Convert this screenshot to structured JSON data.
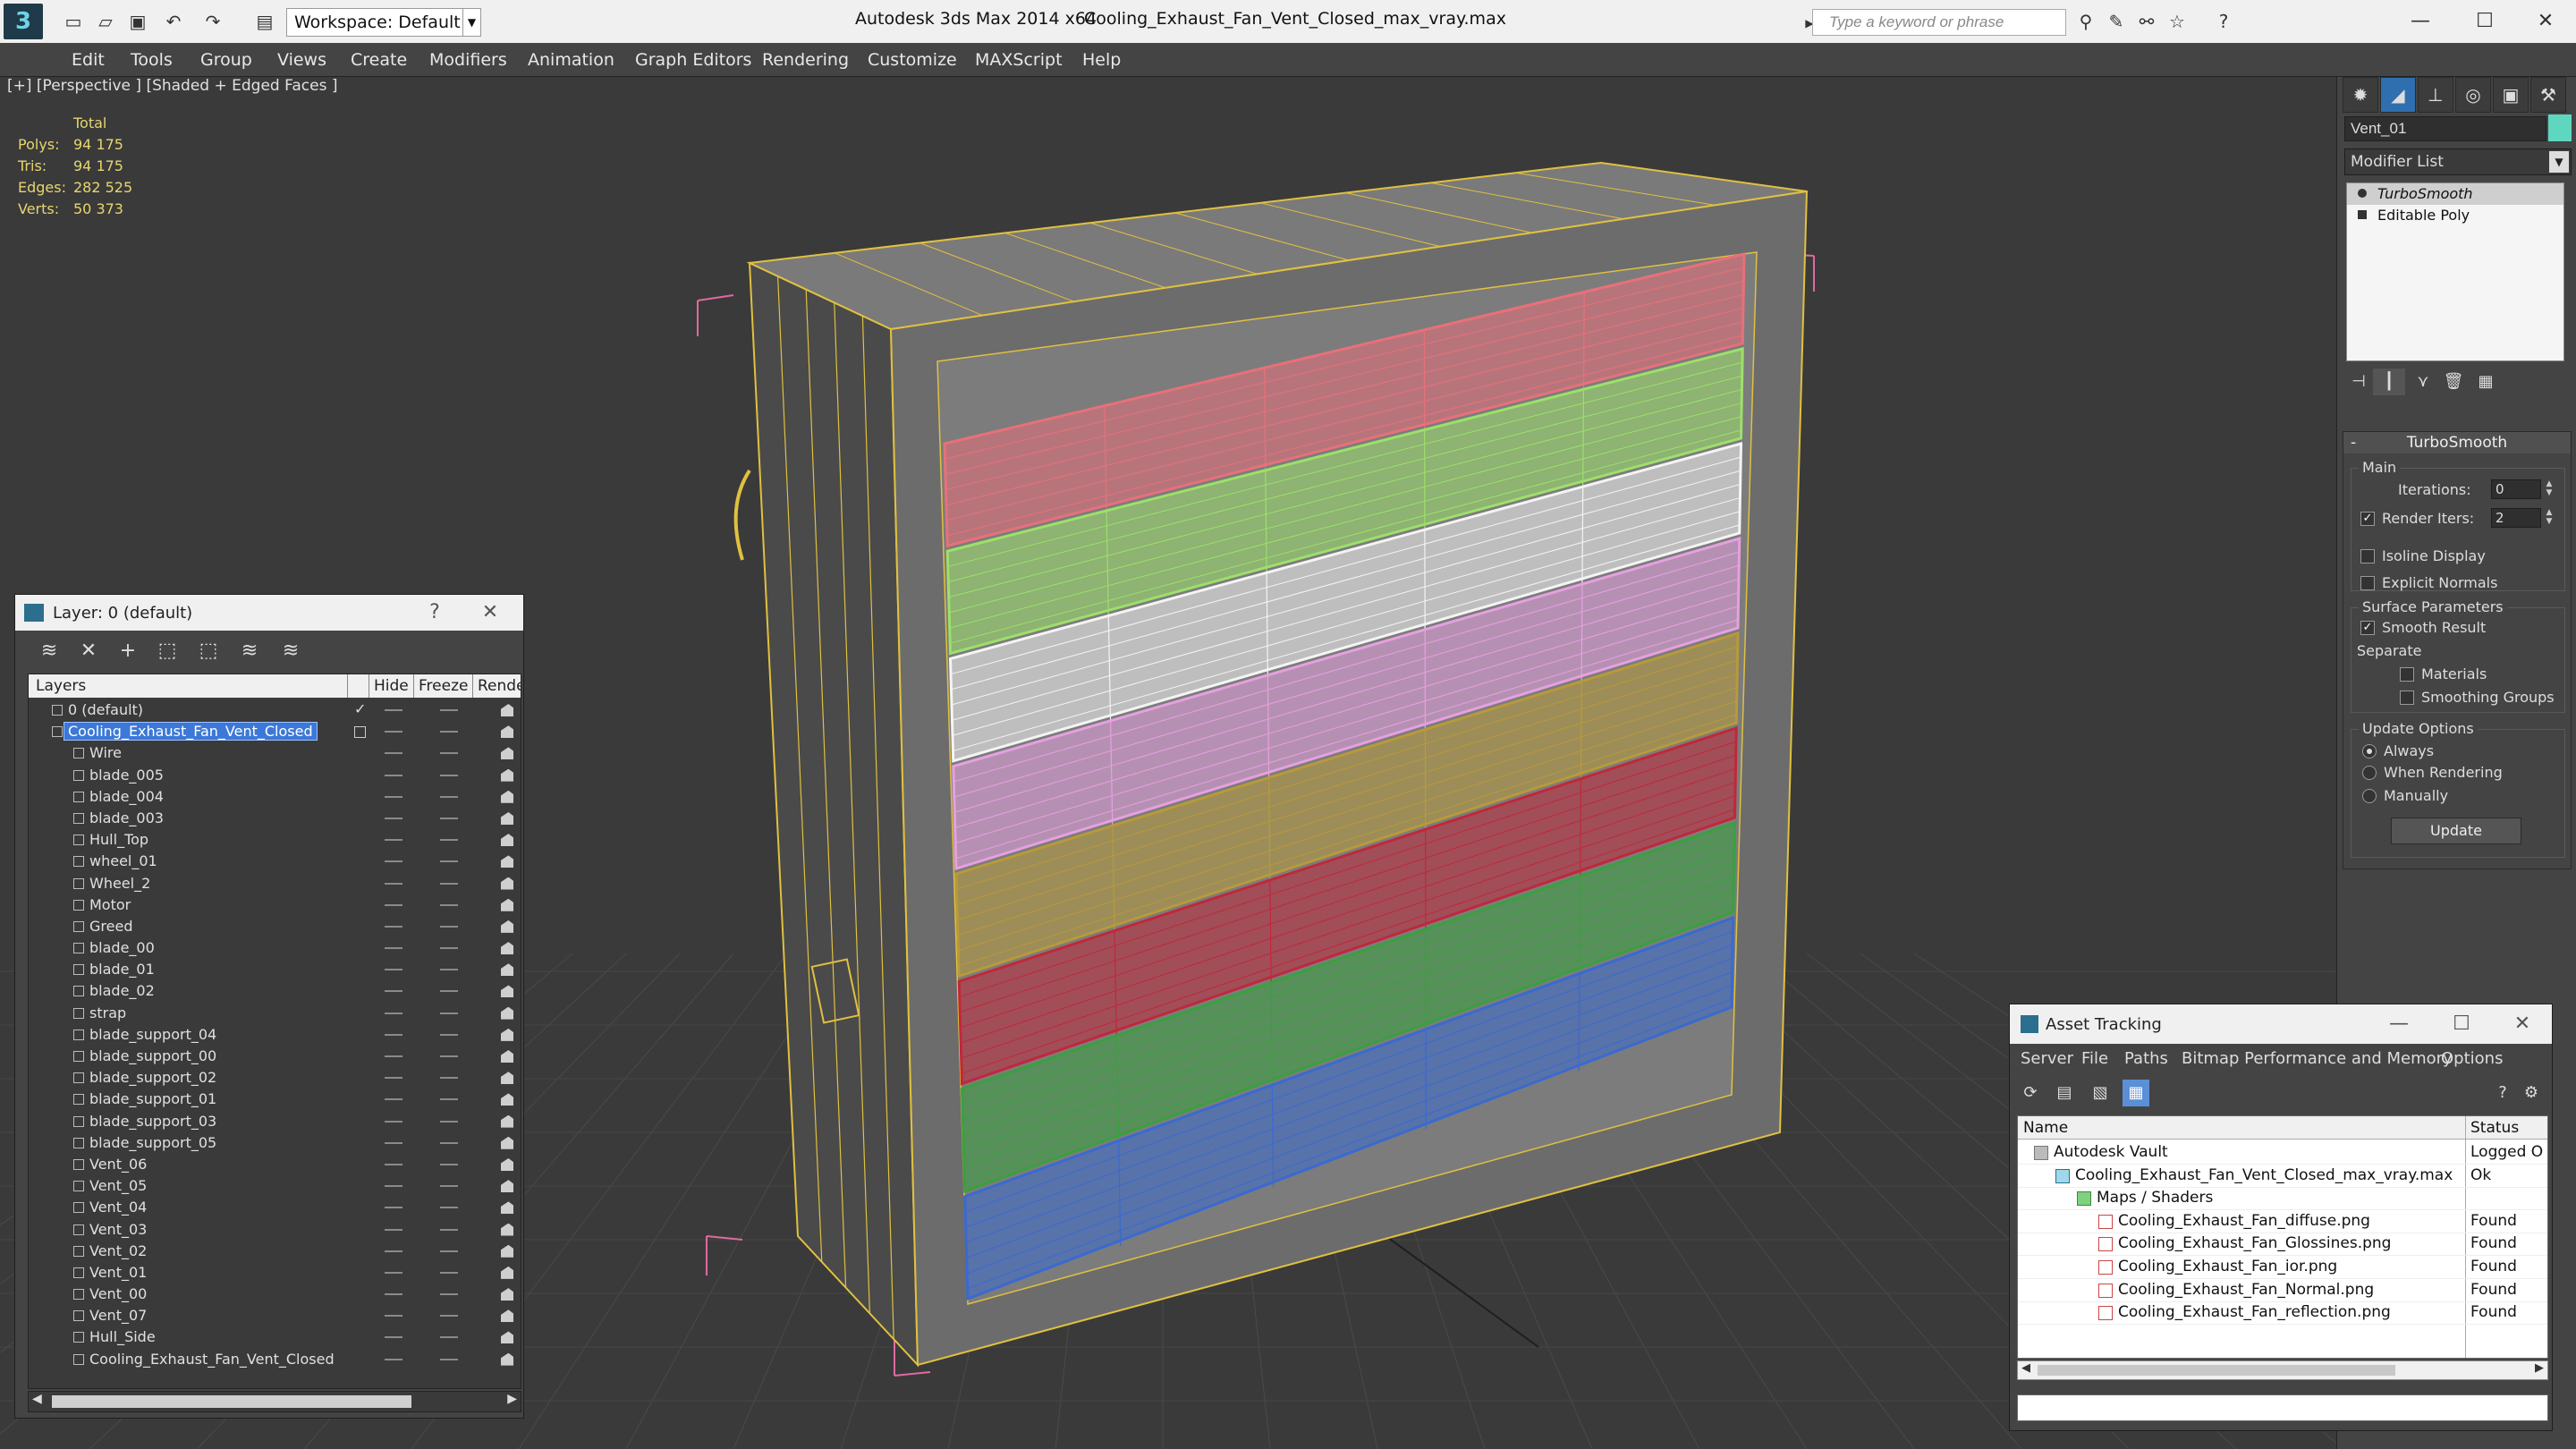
{
  "titlebar": {
    "logo": "3",
    "workspace": "Workspace: Default",
    "app_title": "Autodesk 3ds Max  2014 x64",
    "file_name": "Cooling_Exhaust_Fan_Vent_Closed_max_vray.max",
    "search_placeholder": "Type a keyword or phrase",
    "minimize": "—",
    "maximize": "☐",
    "close": "✕"
  },
  "menubar": [
    "Edit",
    "Tools",
    "Group",
    "Views",
    "Create",
    "Modifiers",
    "Animation",
    "Graph Editors",
    "Rendering",
    "Customize",
    "MAXScript",
    "Help"
  ],
  "viewport": {
    "label": "[+] [Perspective ] [Shaded + Edged Faces ]",
    "stats_header": "Total",
    "stats": [
      {
        "k": "Polys:",
        "v": "94 175"
      },
      {
        "k": "Tris:",
        "v": "94 175"
      },
      {
        "k": "Edges:",
        "v": "282 525"
      },
      {
        "k": "Verts:",
        "v": "50 373"
      }
    ],
    "vent_colors": [
      "#e8707a",
      "#9ce06a",
      "#f4f4f4",
      "#e6a0e0",
      "#b89a3a",
      "#c0283a",
      "#3aa040",
      "#3a6ad0"
    ],
    "frame_color": "#e0c040",
    "bbox_color": "#e06aa0"
  },
  "cmdpanel": {
    "tab_icons": [
      "sun-icon",
      "curve-icon",
      "hierarchy-icon",
      "motion-icon",
      "display-icon",
      "utilities-icon"
    ],
    "object_name": "Vent_01",
    "object_color": "#5fd6c0",
    "modifier_list": "Modifier List",
    "stack": [
      "TurboSmooth",
      "Editable Poly"
    ],
    "rollout_title": "TurboSmooth",
    "main_group": "Main",
    "iterations_label": "Iterations:",
    "iterations_value": "0",
    "render_iters_label": "Render Iters:",
    "render_iters_value": "2",
    "isoline_label": "Isoline Display",
    "explicit_normals_label": "Explicit Normals",
    "surface_group": "Surface Parameters",
    "smooth_result_label": "Smooth Result",
    "separate_label": "Separate",
    "materials_label": "Materials",
    "smoothing_groups_label": "Smoothing Groups",
    "update_group": "Update Options",
    "always_label": "Always",
    "when_rendering_label": "When Rendering",
    "manually_label": "Manually",
    "update_button": "Update"
  },
  "layerdlg": {
    "title": "Layer: 0 (default)",
    "help": "?",
    "close": "✕",
    "columns": {
      "layers": "Layers",
      "hide": "Hide",
      "freeze": "Freeze",
      "render": "Rende"
    },
    "rows": [
      {
        "name": "0 (default)",
        "level": 1,
        "check": true
      },
      {
        "name": "Cooling_Exhaust_Fan_Vent_Closed",
        "level": 1,
        "selected": true
      },
      {
        "name": "Wire",
        "level": 2
      },
      {
        "name": "blade_005",
        "level": 2
      },
      {
        "name": "blade_004",
        "level": 2
      },
      {
        "name": "blade_003",
        "level": 2
      },
      {
        "name": "Hull_Top",
        "level": 2
      },
      {
        "name": "wheel_01",
        "level": 2
      },
      {
        "name": "Wheel_2",
        "level": 2
      },
      {
        "name": "Motor",
        "level": 2
      },
      {
        "name": "Greed",
        "level": 2
      },
      {
        "name": "blade_00",
        "level": 2
      },
      {
        "name": "blade_01",
        "level": 2
      },
      {
        "name": "blade_02",
        "level": 2
      },
      {
        "name": "strap",
        "level": 2
      },
      {
        "name": "blade_support_04",
        "level": 2
      },
      {
        "name": "blade_support_00",
        "level": 2
      },
      {
        "name": "blade_support_02",
        "level": 2
      },
      {
        "name": "blade_support_01",
        "level": 2
      },
      {
        "name": "blade_support_03",
        "level": 2
      },
      {
        "name": "blade_support_05",
        "level": 2
      },
      {
        "name": "Vent_06",
        "level": 2
      },
      {
        "name": "Vent_05",
        "level": 2
      },
      {
        "name": "Vent_04",
        "level": 2
      },
      {
        "name": "Vent_03",
        "level": 2
      },
      {
        "name": "Vent_02",
        "level": 2
      },
      {
        "name": "Vent_01",
        "level": 2
      },
      {
        "name": "Vent_00",
        "level": 2
      },
      {
        "name": "Vent_07",
        "level": 2
      },
      {
        "name": "Hull_Side",
        "level": 2
      },
      {
        "name": "Cooling_Exhaust_Fan_Vent_Closed",
        "level": 2
      }
    ]
  },
  "assetdlg": {
    "title": "Asset Tracking",
    "menus": [
      "Server",
      "File",
      "Paths",
      "Bitmap Performance and Memory",
      "Options"
    ],
    "columns": {
      "name": "Name",
      "status": "Status"
    },
    "rows": [
      {
        "name": "Autodesk Vault",
        "status": "Logged O",
        "level": 0,
        "icon": "vault"
      },
      {
        "name": "Cooling_Exhaust_Fan_Vent_Closed_max_vray.max",
        "status": "Ok",
        "level": 1,
        "icon": "max"
      },
      {
        "name": "Maps / Shaders",
        "status": "",
        "level": 2,
        "icon": "maps"
      },
      {
        "name": "Cooling_Exhaust_Fan_diffuse.png",
        "status": "Found",
        "level": 3,
        "icon": "png"
      },
      {
        "name": "Cooling_Exhaust_Fan_Glossines.png",
        "status": "Found",
        "level": 3,
        "icon": "png"
      },
      {
        "name": "Cooling_Exhaust_Fan_ior.png",
        "status": "Found",
        "level": 3,
        "icon": "png"
      },
      {
        "name": "Cooling_Exhaust_Fan_Normal.png",
        "status": "Found",
        "level": 3,
        "icon": "png"
      },
      {
        "name": "Cooling_Exhaust_Fan_reflection.png",
        "status": "Found",
        "level": 3,
        "icon": "png"
      }
    ]
  }
}
